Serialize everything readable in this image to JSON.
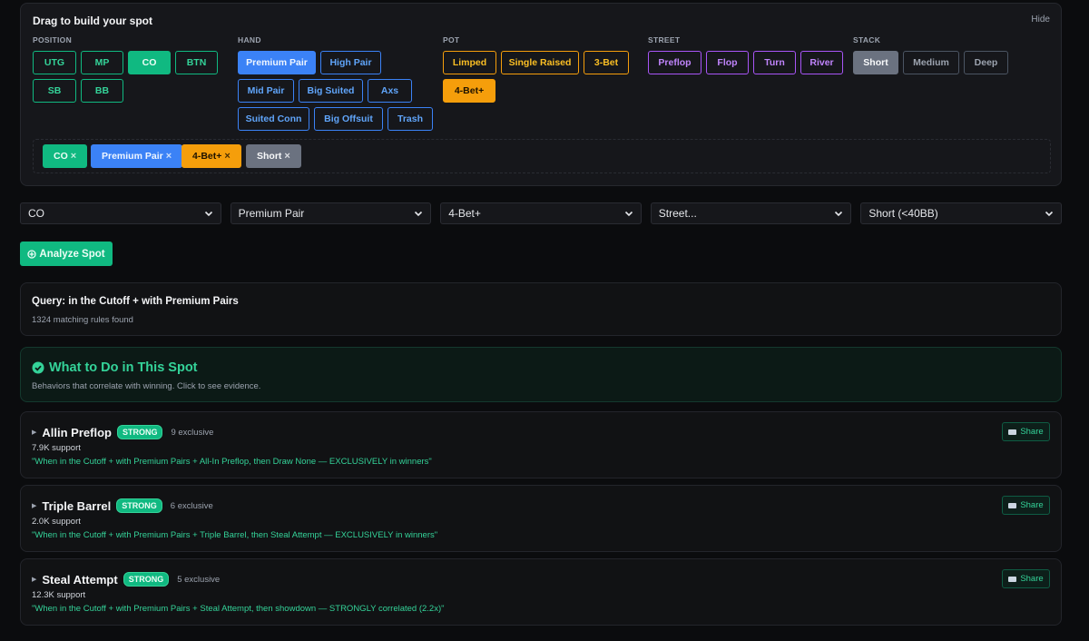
{
  "builder": {
    "title": "Drag to build your spot",
    "hide_label": "Hide",
    "groups": {
      "position": {
        "label": "POSITION",
        "chips": [
          "UTG",
          "MP",
          "CO",
          "BTN",
          "SB",
          "BB"
        ]
      },
      "hand": {
        "label": "HAND",
        "chips": [
          "Premium Pair",
          "High Pair",
          "Mid Pair",
          "Big Suited",
          "Axs",
          "Suited Conn",
          "Big Offsuit",
          "Trash"
        ]
      },
      "pot": {
        "label": "POT",
        "chips": [
          "Limped",
          "Single Raised",
          "3-Bet",
          "4-Bet+"
        ]
      },
      "street": {
        "label": "STREET",
        "chips": [
          "Preflop",
          "Flop",
          "Turn",
          "River"
        ]
      },
      "stack": {
        "label": "STACK",
        "chips": [
          "Short",
          "Medium",
          "Deep"
        ]
      }
    },
    "selected": [
      "CO",
      "Premium Pair",
      "4-Bet+",
      "Short"
    ],
    "remove_glyph": "×"
  },
  "selects": [
    "CO",
    "Premium Pair",
    "4-Bet+",
    "Street...",
    "Short (<40BB)"
  ],
  "analyze_label": "Analyze Spot",
  "query": {
    "title": "Query: in the Cutoff + with Premium Pairs",
    "subtitle": "1324 matching rules found"
  },
  "todo": {
    "title": "What to Do in This Spot",
    "subtitle": "Behaviors that correlate with winning. Click to see evidence."
  },
  "share_label": "Share",
  "cards": [
    {
      "title": "Allin Preflop",
      "badge": "STRONG",
      "exclusive": "9 exclusive",
      "support": "7.9K support",
      "quote": "\"When in the Cutoff + with Premium Pairs + All-In Preflop, then Draw None — EXCLUSIVELY in winners\""
    },
    {
      "title": "Triple Barrel",
      "badge": "STRONG",
      "exclusive": "6 exclusive",
      "support": "2.0K support",
      "quote": "\"When in the Cutoff + with Premium Pairs + Triple Barrel, then Steal Attempt — EXCLUSIVELY in winners\""
    },
    {
      "title": "Steal Attempt",
      "badge": "STRONG",
      "exclusive": "5 exclusive",
      "support": "12.3K support",
      "quote": "\"When in the Cutoff + with Premium Pairs + Steal Attempt, then showdown — STRONGLY correlated (2.2x)\""
    }
  ],
  "colors": {
    "accent_green": "#10b981",
    "blue": "#3b82f6",
    "orange": "#f59e0b",
    "purple": "#a855f7",
    "gray": "#6b7280"
  },
  "icons": {
    "analyze": "target-icon",
    "check": "check-circle-icon",
    "share": "share-icon",
    "caret": "caret-right-icon",
    "dropdown": "chevron-down-icon"
  }
}
